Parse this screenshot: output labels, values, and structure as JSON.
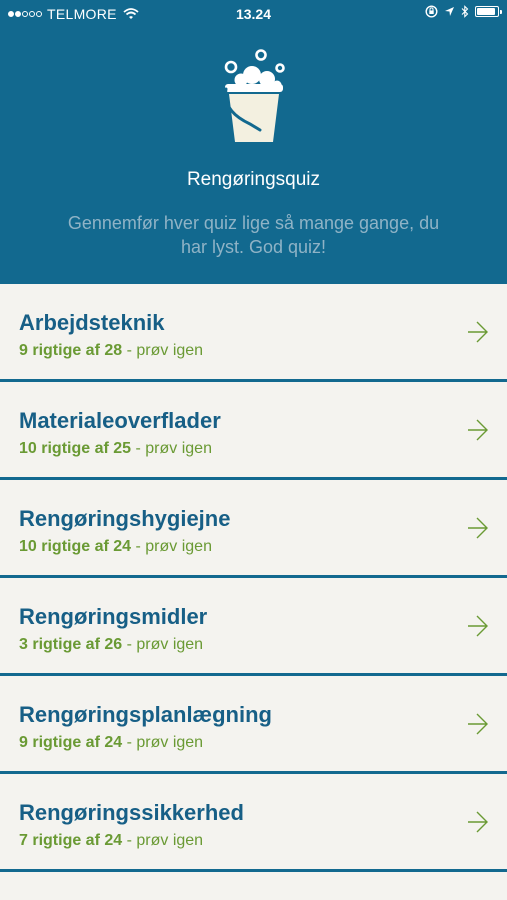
{
  "status_bar": {
    "carrier": "TELMORE",
    "time": "13.24",
    "signal_filled": 2,
    "signal_total": 5,
    "battery_level": 0.9
  },
  "header": {
    "title": "Rengøringsquiz",
    "subtitle": "Gennemfør hver quiz lige så mange gange, du har lyst. God quiz!",
    "logo_icon": "bucket-with-bubbles-icon"
  },
  "quizzes": [
    {
      "title": "Arbejdsteknik",
      "score": "9 rigtige af 28",
      "retry": " - prøv igen"
    },
    {
      "title": "Materialeoverflader",
      "score": "10 rigtige af 25",
      "retry": " - prøv igen"
    },
    {
      "title": "Rengøringshygiejne",
      "score": "10 rigtige af 24",
      "retry": " - prøv igen"
    },
    {
      "title": "Rengøringsmidler",
      "score": "3 rigtige af 26",
      "retry": " - prøv igen"
    },
    {
      "title": "Rengøringsplanlægning",
      "score": "9 rigtige af 24",
      "retry": " - prøv igen"
    },
    {
      "title": "Rengøringssikkerhed",
      "score": "7 rigtige af 24",
      "retry": " - prøv igen"
    }
  ],
  "colors": {
    "header_bg": "#12698f",
    "title_blue": "#175f86",
    "score_green": "#6a9a34",
    "list_bg": "#f4f3ef"
  }
}
